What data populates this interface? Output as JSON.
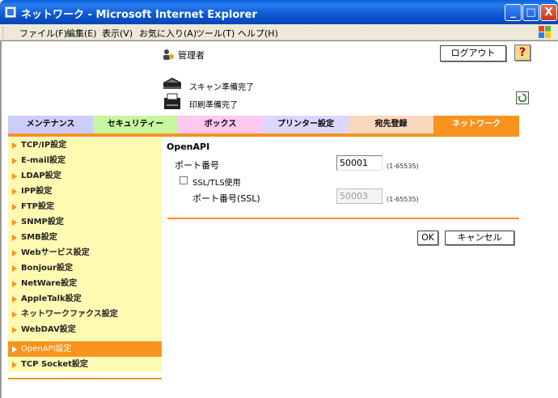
{
  "window": {
    "title": "ネットワーク - Microsoft Internet Explorer",
    "buttons": [
      "_",
      "□",
      "X"
    ]
  },
  "menubar": {
    "items": [
      "ファイル(F)",
      "編集(E)",
      "表示(V)",
      "お気に入り(A)",
      "ツール(T)",
      "ヘルプ(H)"
    ]
  },
  "header": {
    "user_label": "管理者",
    "logout_label": "ログアウト",
    "scan_status": "スキャン準備完了",
    "print_status": "印刷準備完了"
  },
  "tabs": [
    {
      "label": "メンテナンス",
      "color": "#ccccff"
    },
    {
      "label": "セキュリティー",
      "color": "#c8f5a0"
    },
    {
      "label": "ボックス",
      "color": "#ffc8f0"
    },
    {
      "label": "プリンター設定",
      "color": "#dcd7ff"
    },
    {
      "label": "宛先登録",
      "color": "#fbd7c0"
    },
    {
      "label": "ネットワーク",
      "color": "#f7931e"
    }
  ],
  "sidebar": {
    "items": [
      {
        "label": "TCP/IP設定"
      },
      {
        "label": "E-mail設定"
      },
      {
        "label": "LDAP設定"
      },
      {
        "label": "IPP設定"
      },
      {
        "label": "FTP設定"
      },
      {
        "label": "SNMP設定"
      },
      {
        "label": "SMB設定"
      },
      {
        "label": "Webサービス設定"
      },
      {
        "label": "Bonjour設定"
      },
      {
        "label": "NetWare設定"
      },
      {
        "label": "AppleTalk設定"
      },
      {
        "label": "ネットワークファクス設定"
      },
      {
        "label": "WebDAV設定"
      },
      {
        "label": "OpenAPI設定"
      },
      {
        "label": "TCP Socket設定"
      }
    ]
  },
  "main": {
    "section_title": "OpenAPI",
    "port_label": "ポート番号",
    "port_value": "50001",
    "port_range": "(1-65535)",
    "ssl_checkbox_label": "SSL/TLS使用",
    "ssl_port_label": "ポート番号(SSL)",
    "ssl_port_value": "50003",
    "ssl_port_range": "(1-65535)",
    "ok_label": "OK",
    "cancel_label": "キャンセル"
  }
}
